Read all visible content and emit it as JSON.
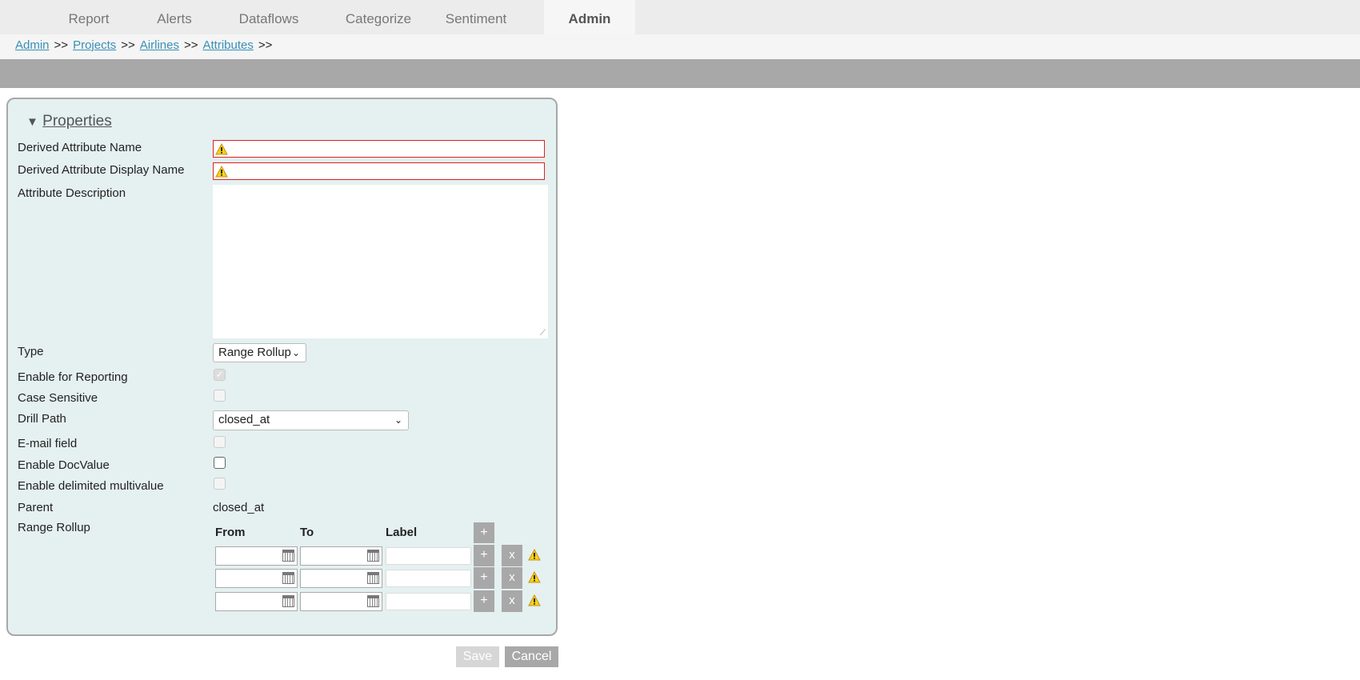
{
  "tabs": [
    "Report",
    "Alerts",
    "Dataflows",
    "Categorize",
    "Sentiment",
    "Admin"
  ],
  "breadcrumb": {
    "items": [
      "Admin",
      "Projects",
      "Airlines",
      "Attributes"
    ],
    "separator": ">>"
  },
  "panel": {
    "title": "Properties",
    "toggle_icon": "▼"
  },
  "labels": {
    "name": "Derived Attribute Name",
    "display": "Derived Attribute Display Name",
    "desc": "Attribute Description",
    "type": "Type",
    "reporting": "Enable for Reporting",
    "case": "Case Sensitive",
    "drill": "Drill Path",
    "email": "E-mail field",
    "docvalue": "Enable DocValue",
    "delimited": "Enable delimited multivalue",
    "parent": "Parent",
    "range": "Range Rollup"
  },
  "values": {
    "type": "Range Rollup",
    "drill": "closed_at",
    "parent": "closed_at"
  },
  "range": {
    "headers": [
      "From",
      "To",
      "Label"
    ],
    "add": "+",
    "remove": "x",
    "rows": 3
  },
  "buttons": {
    "save": "Save",
    "cancel": "Cancel"
  },
  "colors": {
    "link": "#3a8fb7",
    "error": "#e02020",
    "panel": "#e5f0f0"
  }
}
